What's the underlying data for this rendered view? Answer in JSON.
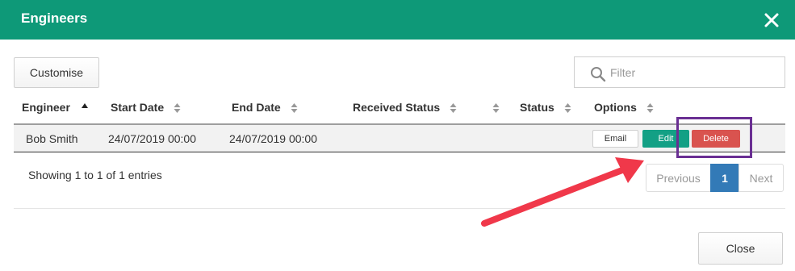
{
  "header": {
    "title": "Engineers",
    "close_icon": "close-icon"
  },
  "toolbar": {
    "customise_label": "Customise"
  },
  "filter": {
    "placeholder": "Filter",
    "value": "",
    "icon": "search-icon"
  },
  "table": {
    "columns": [
      {
        "label": "Engineer",
        "sort": "asc"
      },
      {
        "label": "Start Date",
        "sort": "none"
      },
      {
        "label": "End Date",
        "sort": "none"
      },
      {
        "label": "Received Status",
        "sort": "none"
      },
      {
        "label": "",
        "sort": "none"
      },
      {
        "label": "Status",
        "sort": "none"
      },
      {
        "label": "Options",
        "sort": "none"
      }
    ],
    "rows": [
      {
        "engineer": "Bob Smith",
        "start_date": "24/07/2019 00:00",
        "end_date": "24/07/2019 00:00",
        "received_status": "",
        "status": "",
        "actions": {
          "email": "Email",
          "edit": "Edit",
          "delete": "Delete"
        }
      }
    ]
  },
  "pagination": {
    "info": "Showing 1 to 1 of 1 entries",
    "previous": "Previous",
    "current": "1",
    "next": "Next"
  },
  "footer": {
    "close_label": "Close"
  },
  "colors": {
    "header_bg": "#0e9978",
    "edit_bg": "#13a085",
    "delete_bg": "#d9534f",
    "page_active": "#337ab7",
    "highlight": "#6a2f93",
    "arrow": "#f0384a"
  }
}
